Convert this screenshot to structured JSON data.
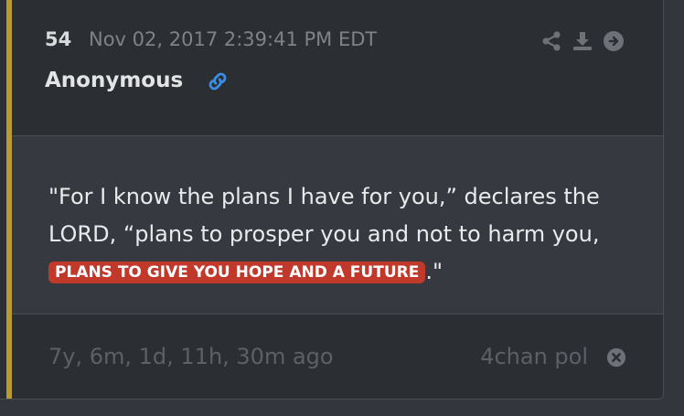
{
  "post": {
    "number": "54",
    "timestamp": "Nov 02, 2017 2:39:41 PM EDT",
    "author": "Anonymous",
    "message_part1": "\"For I know the plans I have for you,” declares the LORD, “plans to prosper you and not to harm you, ",
    "message_highlight": "PLANS TO GIVE YOU HOPE AND A FUTURE",
    "message_part2": ".\"",
    "age": "7y, 6m, 1d, 11h, 30m ago",
    "source": "4chan pol"
  },
  "icons": {
    "link": "link-icon",
    "share": "share-icon",
    "download": "download-icon",
    "go": "arrow-right-circle-icon",
    "close": "close-circle-icon"
  },
  "colors": {
    "accent_bar": "#b89a33",
    "highlight_bg": "#c0392b",
    "link_icon": "#3a8ee6"
  }
}
